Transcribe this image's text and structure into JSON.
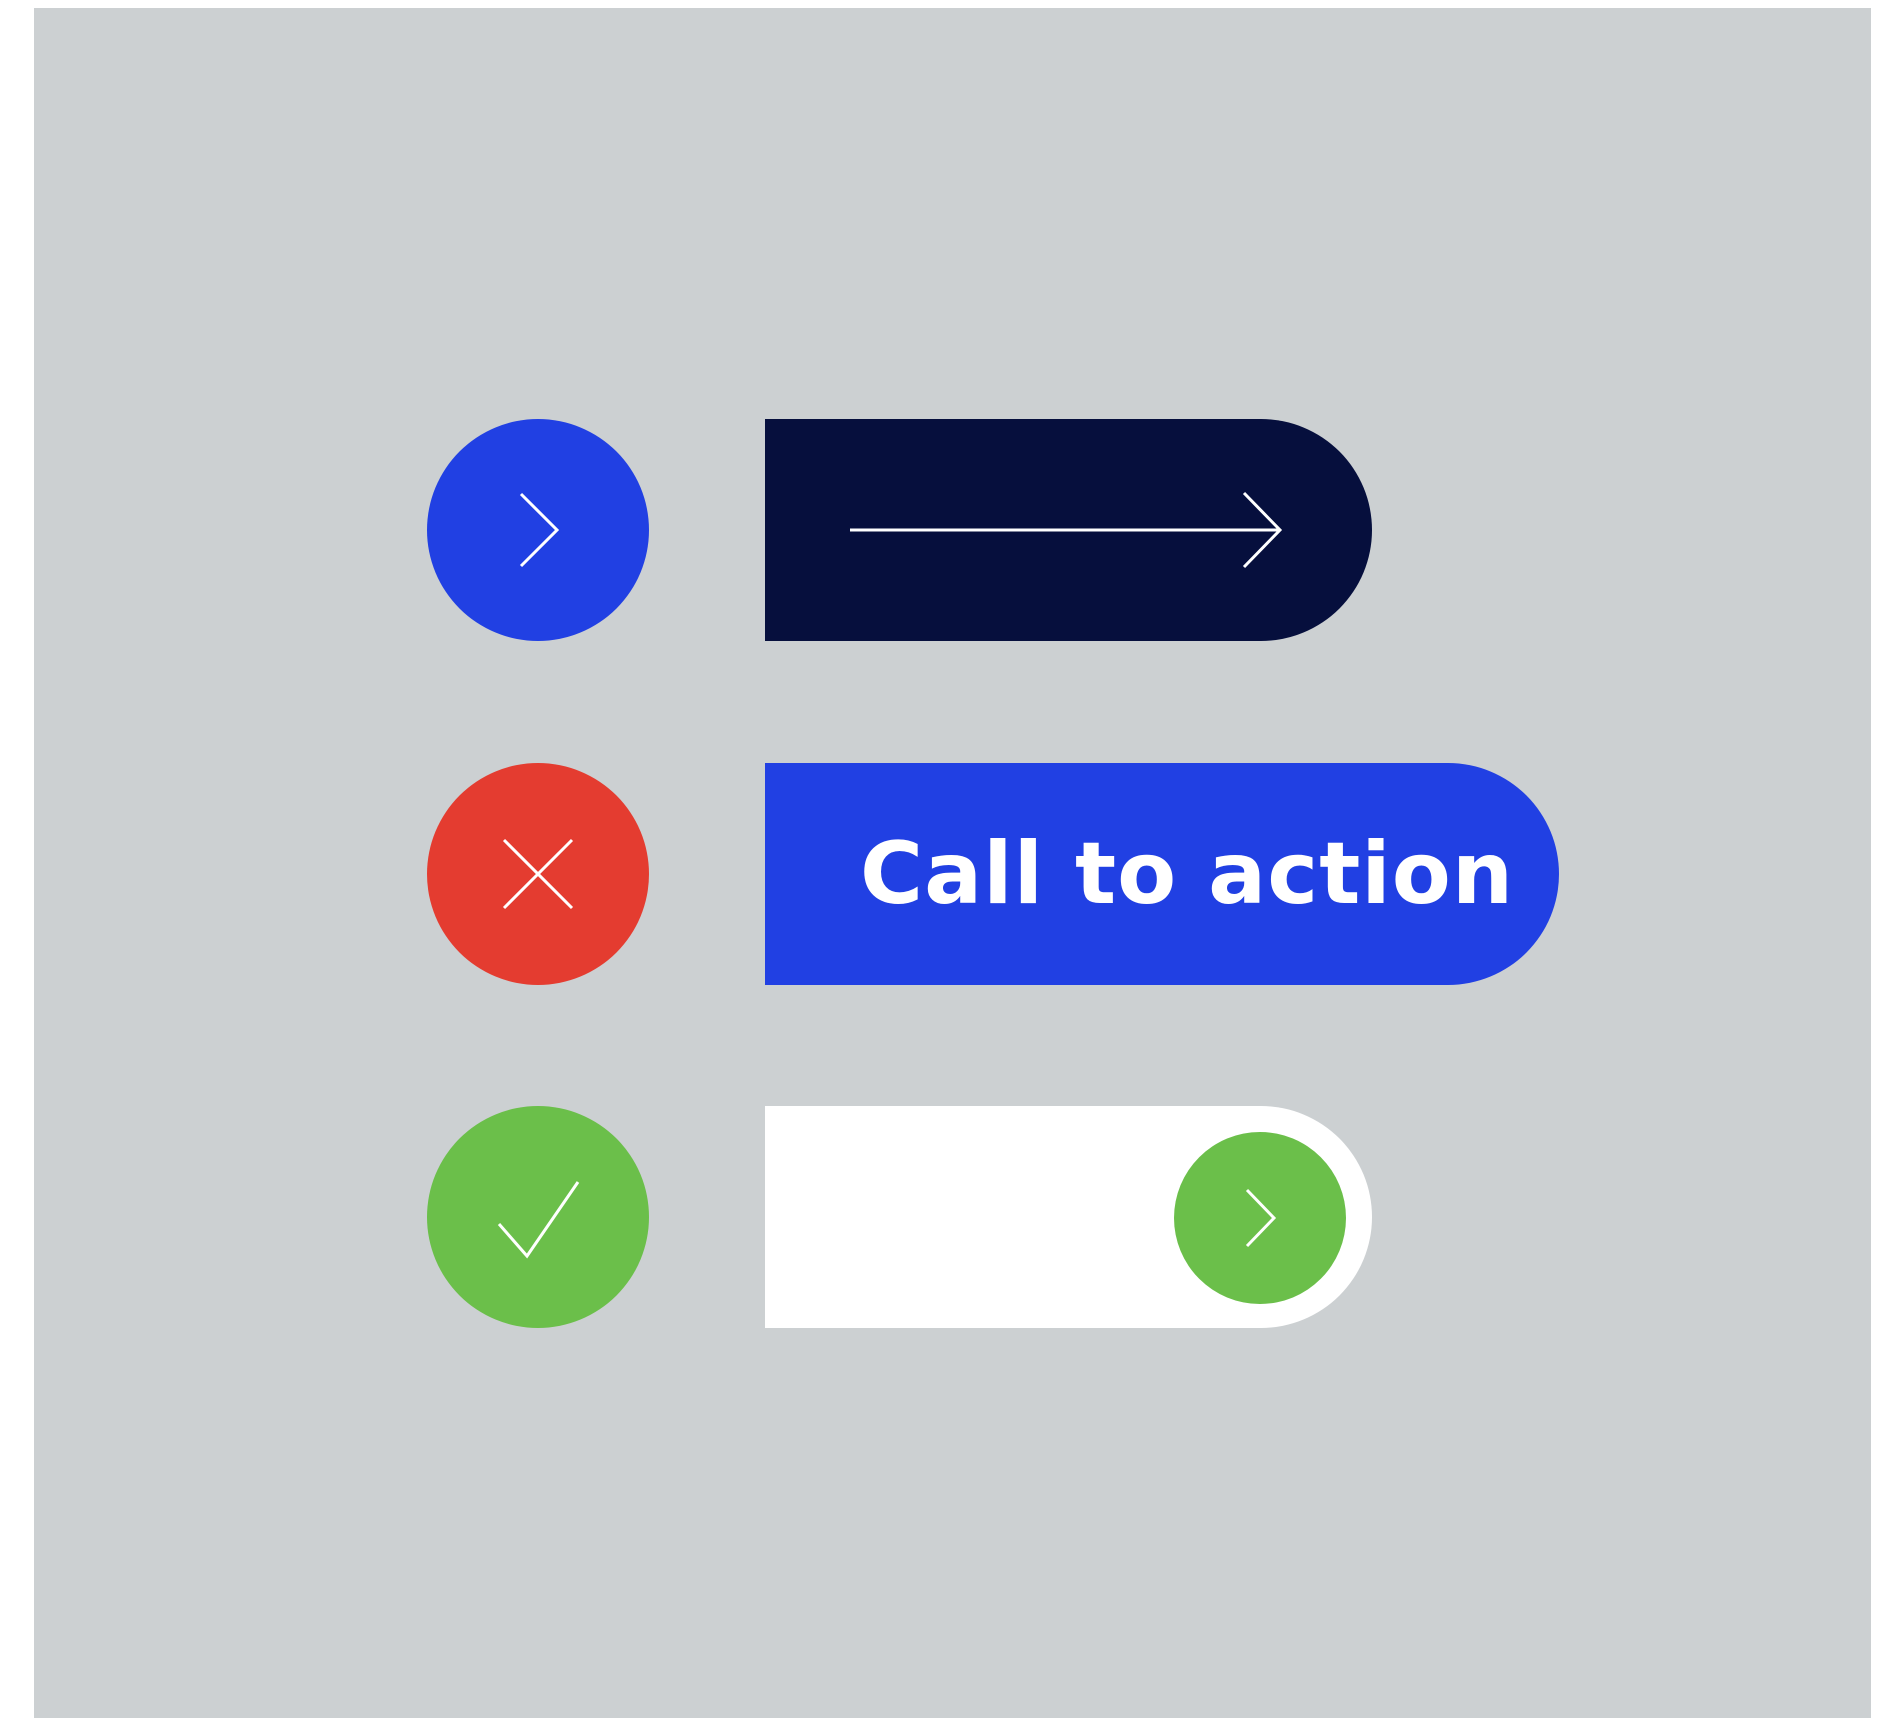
{
  "colors": {
    "background": "#ccd0d2",
    "accent_blue": "#2140e3",
    "navy": "#060f3d",
    "danger_red": "#e43c30",
    "success_green": "#6bbf4a",
    "white": "#ffffff"
  },
  "icon_buttons": [
    {
      "icon": "chevron-right-icon",
      "color": "#2140e3"
    },
    {
      "icon": "close-icon",
      "color": "#e43c30"
    },
    {
      "icon": "check-icon",
      "color": "#6bbf4a"
    }
  ],
  "pills": {
    "arrow_button": {
      "icon": "long-arrow-right-icon",
      "color": "#060f3d"
    },
    "cta_button": {
      "label": "Call to action",
      "color": "#2140e3"
    },
    "toggle": {
      "state": "on",
      "track_color": "#ffffff",
      "knob_color": "#6bbf4a",
      "knob_icon": "chevron-right-icon"
    }
  }
}
